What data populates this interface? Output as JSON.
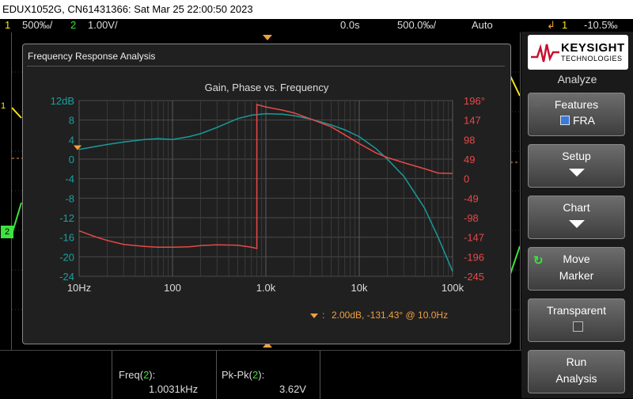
{
  "title_bar": "EDUX1052G, CN61431366: Sat Mar 25 22:00:50 2023",
  "status": {
    "ch1_num": "1",
    "ch1_scale": "500‰/",
    "ch2_num": "2",
    "ch2_scale": "1.00V/",
    "delay": "0.0s",
    "timebase": "500.0‰/",
    "trigger_mode": "Auto",
    "trigger_source": "1",
    "trigger_level": "-10.5‰"
  },
  "scope_markers": {
    "ch1_marker": "1",
    "ch2_marker": "2"
  },
  "dialog": {
    "title": "Frequency Response Analysis",
    "chart_title": "Gain, Phase vs. Frequency",
    "marker_readout": "2.00dB, -131.43° @ 10.0Hz",
    "marker_prefix": ":"
  },
  "chart_data": {
    "type": "line",
    "title": "Gain, Phase vs. Frequency",
    "x_scale": "log",
    "xlim": [
      10,
      100000
    ],
    "x_ticks": [
      "10Hz",
      "100",
      "1.0k",
      "10k",
      "100k"
    ],
    "y_left_ticks": [
      "12dB",
      "8",
      "4",
      "0",
      "-4",
      "-8",
      "-12",
      "-16",
      "-20",
      "-24"
    ],
    "y_left_lim": [
      -24,
      12
    ],
    "y_right_ticks": [
      "196°",
      "147",
      "98",
      "49",
      "0",
      "-49",
      "-98",
      "-147",
      "-196",
      "-245"
    ],
    "y_right_lim": [
      -245,
      196
    ],
    "grid": true,
    "series": [
      {
        "color": "#1a9a9a",
        "axis": "left",
        "x": [
          10,
          20,
          30,
          50,
          70,
          100,
          150,
          200,
          300,
          500,
          700,
          1000,
          1500,
          2000,
          3000,
          5000,
          7000,
          10000,
          15000,
          20000,
          30000,
          50000,
          70000,
          100000
        ],
        "y": [
          2.0,
          3.0,
          3.5,
          4.0,
          4.2,
          4.0,
          4.6,
          5.2,
          6.5,
          8.3,
          9.0,
          9.3,
          9.2,
          8.9,
          8.2,
          7.0,
          6.0,
          4.6,
          2.2,
          0.0,
          -3.5,
          -10.0,
          -16.0,
          -23.0
        ]
      },
      {
        "color": "#e84848",
        "axis": "right",
        "x": [
          10,
          15,
          20,
          30,
          50,
          70,
          100,
          150,
          200,
          300,
          500,
          700,
          800,
          800.5,
          1000,
          1500,
          2000,
          3000,
          5000,
          7000,
          10000,
          15000,
          20000,
          30000,
          50000,
          70000,
          100000
        ],
        "y": [
          -131,
          -146,
          -155,
          -165,
          -170,
          -172,
          -172,
          -171,
          -168,
          -166,
          -167,
          -172,
          -175,
          186,
          180,
          172,
          165,
          150,
          130,
          110,
          88,
          65,
          53,
          40,
          25,
          14,
          13
        ]
      }
    ],
    "marker": {
      "x": 10,
      "gain_db": 2.0,
      "phase_deg": -131.43
    }
  },
  "sidebar": {
    "brand_name": "KEYSIGHT",
    "brand_sub": "TECHNOLOGIES",
    "menu_title": "Analyze",
    "features_label": "Features",
    "features_value": "FRA",
    "setup_label": "Setup",
    "chart_label": "Chart",
    "move_marker_l1": "Move",
    "move_marker_l2": "Marker",
    "transparent_label": "Transparent",
    "run_l1": "Run",
    "run_l2": "Analysis"
  },
  "measurements": {
    "freq_label": "Freq(",
    "freq_ch": "2",
    "freq_close": "):",
    "freq_value": "1.0031kHz",
    "pkpk_label": "Pk-Pk(",
    "pkpk_ch": "2",
    "pkpk_close": "):",
    "pkpk_value": "3.62V"
  },
  "colors": {
    "ch1": "#f5e61e",
    "ch2": "#3ee13e",
    "gain": "#1a9a9a",
    "phase": "#e84848",
    "marker": "#f0a040",
    "trigger": "#f0a040"
  }
}
